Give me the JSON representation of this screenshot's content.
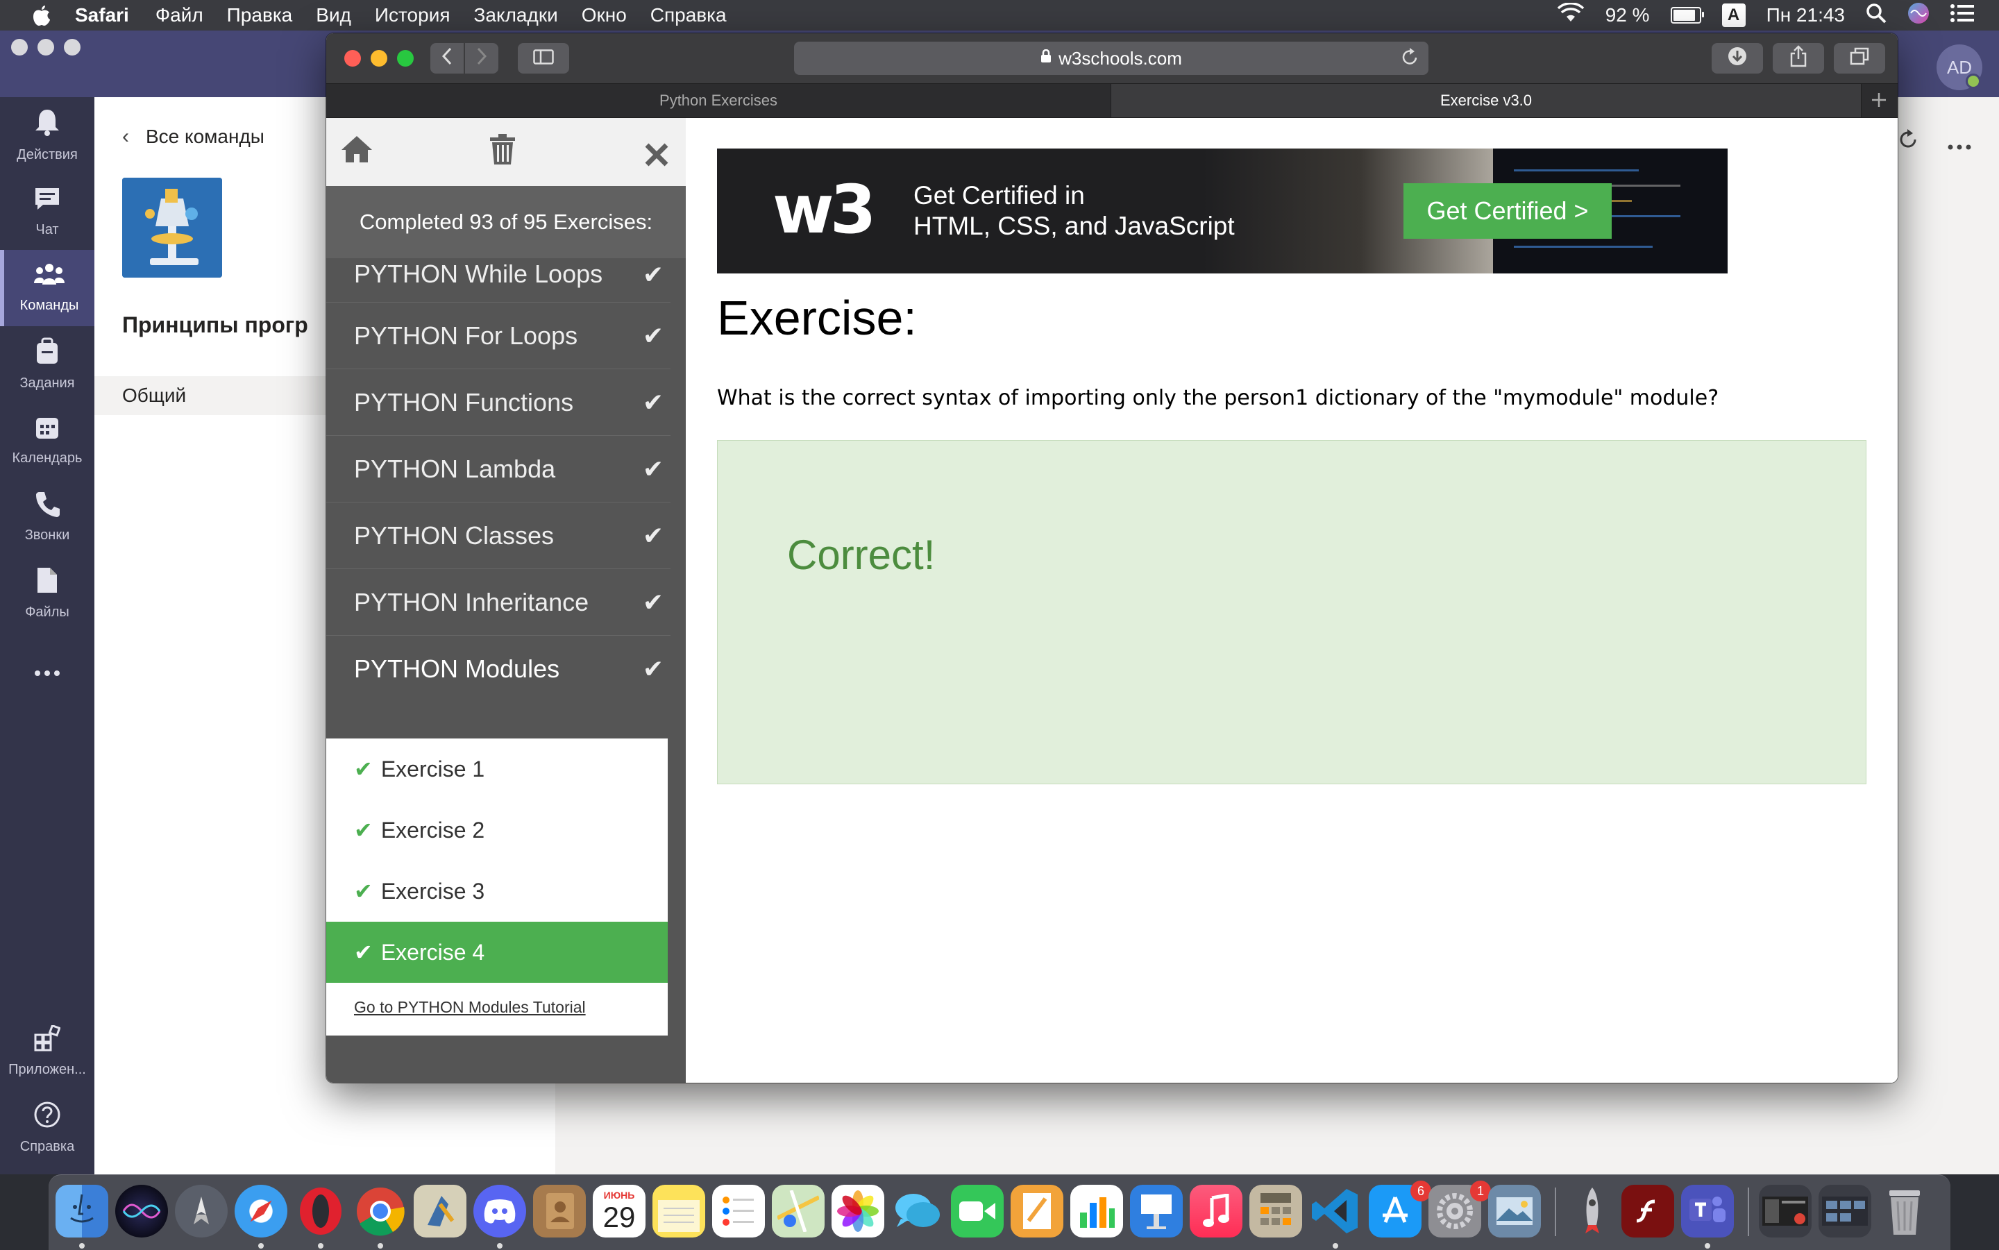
{
  "menubar": {
    "app": "Safari",
    "items": [
      "Файл",
      "Правка",
      "Вид",
      "История",
      "Закладки",
      "Окно",
      "Справка"
    ],
    "battery": "92 %",
    "input_source": "A",
    "clock": "Пн 21:43",
    "battery_level": 0.92
  },
  "teams": {
    "avatar_initials": "AD",
    "rail": [
      {
        "label": "Действия",
        "icon": "bell-icon"
      },
      {
        "label": "Чат",
        "icon": "chat-icon"
      },
      {
        "label": "Команды",
        "icon": "teams-icon"
      },
      {
        "label": "Задания",
        "icon": "assignments-icon"
      },
      {
        "label": "Календарь",
        "icon": "calendar-icon"
      },
      {
        "label": "Звонки",
        "icon": "phone-icon"
      },
      {
        "label": "Файлы",
        "icon": "file-icon"
      },
      {
        "label": "Приложен...",
        "icon": "apps-icon"
      },
      {
        "label": "Справка",
        "icon": "help-icon"
      }
    ],
    "back_label": "Все команды",
    "team_name": "Принципы прогр",
    "channel": "Общий"
  },
  "safari": {
    "url": "w3schools.com",
    "tabs": [
      {
        "label": "Python Exercises",
        "active": false
      },
      {
        "label": "Exercise v3.0",
        "active": true
      }
    ]
  },
  "sidebar": {
    "progress": "Completed 93 of 95 Exercises:",
    "topics": [
      "PYTHON While Loops",
      "PYTHON For Loops",
      "PYTHON Functions",
      "PYTHON Lambda",
      "PYTHON Classes",
      "PYTHON Inheritance",
      "PYTHON Modules"
    ],
    "exercises": [
      "Exercise 1",
      "Exercise 2",
      "Exercise 3",
      "Exercise 4"
    ],
    "selected_exercise": "Exercise 4",
    "tutorial_link": "Go to PYTHON Modules Tutorial"
  },
  "banner": {
    "logo": "w3",
    "line1": "Get Certified in",
    "line2": "HTML, CSS, and JavaScript",
    "button": "Get Certified >"
  },
  "exercise": {
    "title": "Exercise:",
    "question": "What is the correct syntax of importing only the person1 dictionary of the \"mymodule\" module?",
    "result": "Correct!"
  },
  "dock": {
    "calendar_month": "ИЮНЬ",
    "calendar_day": "29",
    "appstore_badge": "6",
    "settings_badge": "1"
  },
  "colors": {
    "w3_green": "#4caf50",
    "sidebar_bg": "#555555",
    "correct_bg": "#e1efdb",
    "correct_text": "#4c8c3e",
    "teams_purple": "#464775"
  }
}
